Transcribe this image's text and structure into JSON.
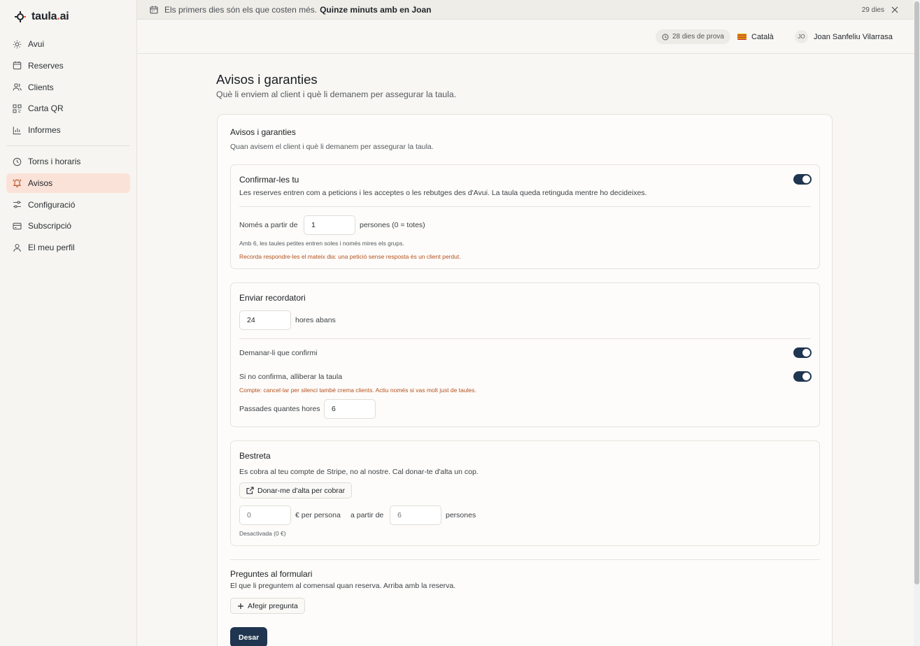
{
  "app": {
    "logo_main": "taula",
    "logo_dot": ".",
    "logo_ai": "ai"
  },
  "sidebar": {
    "items": [
      {
        "label": "Avui",
        "icon": "sun-icon"
      },
      {
        "label": "Reserves",
        "icon": "calendar-icon"
      },
      {
        "label": "Clients",
        "icon": "users-icon"
      },
      {
        "label": "Carta QR",
        "icon": "qr-icon"
      },
      {
        "label": "Informes",
        "icon": "chart-icon"
      },
      {
        "label": "Torns i horaris",
        "icon": "clock-icon"
      },
      {
        "label": "Avisos",
        "icon": "bell-icon",
        "active": true
      },
      {
        "label": "Configuració",
        "icon": "sliders-icon"
      },
      {
        "label": "Subscripció",
        "icon": "card-icon"
      },
      {
        "label": "El meu perfil",
        "icon": "user-icon"
      }
    ]
  },
  "banner": {
    "text": "Els primers dies són els que costen més.",
    "link": "Quinze minuts amb en Joan",
    "days": "29 dies"
  },
  "header": {
    "trial": "28 dies de prova",
    "language": "Català",
    "avatar_initials": "JO",
    "user_name": "Joan Sanfeliu Vilarrasa"
  },
  "page": {
    "title": "Avisos i garanties",
    "subtitle": "Què li enviem al client i què li demanem per assegurar la taula."
  },
  "card": {
    "title": "Avisos i garanties",
    "subtitle": "Quan avisem el client i què li demanem per assegurar la taula."
  },
  "confirm": {
    "title": "Confirmar-les tu",
    "description": "Les reserves entren com a peticions i les acceptes o les rebutges des d'Avui. La taula queda retinguda mentre ho decideixes.",
    "enabled": true,
    "from_label": "Només a partir de",
    "from_value": "1",
    "from_suffix": "persones (0 = totes)",
    "hint": "Amb 6, les taules petites entren soles i només mires els grups.",
    "warning": "Recorda respondre-les el mateix dia: una petició sense resposta és un client perdut."
  },
  "reminder": {
    "title": "Enviar recordatori",
    "hours_value": "24",
    "hours_suffix": "hores abans",
    "ask_confirm_label": "Demanar-li que confirmi",
    "ask_confirm_enabled": true,
    "release_label": "Si no confirma, alliberar la taula",
    "release_enabled": true,
    "release_warning": "Compte: cancel·lar per silenci també crema clients. Actiu només si vas molt just de taules.",
    "after_label": "Passades quantes hores",
    "after_value": "6"
  },
  "deposit": {
    "title": "Bestreta",
    "description": "Es cobra al teu compte de Stripe, no al nostre. Cal donar-te d'alta un cop.",
    "stripe_button": "Donar-me d'alta per cobrar",
    "amount_placeholder": "0",
    "amount_suffix": "€ per persona",
    "from_label": "a partir de",
    "from_placeholder": "6",
    "from_suffix": "persones",
    "status": "Desactivada (0 €)"
  },
  "questions": {
    "title": "Preguntes al formulari",
    "subtitle": "El que li preguntem al comensal quan reserva. Arriba amb la reserva.",
    "add_button": "Afegir pregunta"
  },
  "actions": {
    "save": "Desar"
  },
  "colors": {
    "accent": "#e4572e",
    "primary": "#1f3550",
    "active_nav": "#fbe2d8",
    "warning": "#b4501e"
  }
}
